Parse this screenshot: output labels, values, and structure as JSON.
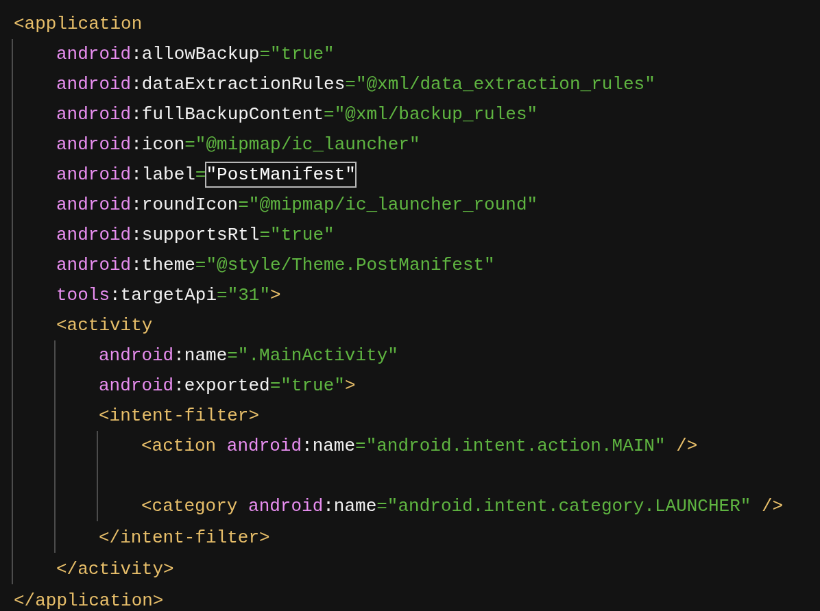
{
  "editor": {
    "lines": [
      {
        "kind": "code",
        "tokens": [
          {
            "kind": "tag",
            "text": "<application"
          }
        ],
        "children": [
          {
            "kind": "code",
            "tokens": [
              {
                "kind": "ns",
                "text": "android"
              },
              {
                "kind": "attr",
                "text": ":allowBackup"
              },
              {
                "kind": "value",
                "text": "=\"true\""
              }
            ]
          },
          {
            "kind": "code",
            "tokens": [
              {
                "kind": "ns",
                "text": "android"
              },
              {
                "kind": "attr",
                "text": ":dataExtractionRules"
              },
              {
                "kind": "value",
                "text": "=\"@xml/data_extraction_rules\""
              }
            ]
          },
          {
            "kind": "code",
            "tokens": [
              {
                "kind": "ns",
                "text": "android"
              },
              {
                "kind": "attr",
                "text": ":fullBackupContent"
              },
              {
                "kind": "value",
                "text": "=\"@xml/backup_rules\""
              }
            ]
          },
          {
            "kind": "code",
            "tokens": [
              {
                "kind": "ns",
                "text": "android"
              },
              {
                "kind": "attr",
                "text": ":icon"
              },
              {
                "kind": "value",
                "text": "=\"@mipmap/ic_launcher\""
              }
            ]
          },
          {
            "kind": "code",
            "tokens": [
              {
                "kind": "ns",
                "text": "android"
              },
              {
                "kind": "attr",
                "text": ":label"
              },
              {
                "kind": "value",
                "text": "="
              },
              {
                "kind": "highlight",
                "text": "\"PostManifest\""
              }
            ]
          },
          {
            "kind": "code",
            "tokens": [
              {
                "kind": "ns",
                "text": "android"
              },
              {
                "kind": "attr",
                "text": ":roundIcon"
              },
              {
                "kind": "value",
                "text": "=\"@mipmap/ic_launcher_round\""
              }
            ]
          },
          {
            "kind": "code",
            "tokens": [
              {
                "kind": "ns",
                "text": "android"
              },
              {
                "kind": "attr",
                "text": ":supportsRtl"
              },
              {
                "kind": "value",
                "text": "=\"true\""
              }
            ]
          },
          {
            "kind": "code",
            "tokens": [
              {
                "kind": "ns",
                "text": "android"
              },
              {
                "kind": "attr",
                "text": ":theme"
              },
              {
                "kind": "value",
                "text": "=\"@style/Theme.PostManifest\""
              }
            ]
          },
          {
            "kind": "code",
            "tokens": [
              {
                "kind": "ns",
                "text": "tools"
              },
              {
                "kind": "attr",
                "text": ":targetApi"
              },
              {
                "kind": "value",
                "text": "=\"31\""
              },
              {
                "kind": "tag",
                "text": ">"
              }
            ]
          },
          {
            "kind": "code",
            "tokens": [
              {
                "kind": "tag",
                "text": "<activity"
              }
            ],
            "children": [
              {
                "kind": "code",
                "tokens": [
                  {
                    "kind": "ns",
                    "text": "android"
                  },
                  {
                    "kind": "attr",
                    "text": ":name"
                  },
                  {
                    "kind": "value",
                    "text": "=\".MainActivity\""
                  }
                ]
              },
              {
                "kind": "code",
                "tokens": [
                  {
                    "kind": "ns",
                    "text": "android"
                  },
                  {
                    "kind": "attr",
                    "text": ":exported"
                  },
                  {
                    "kind": "value",
                    "text": "=\"true\""
                  },
                  {
                    "kind": "tag",
                    "text": ">"
                  }
                ]
              },
              {
                "kind": "code",
                "tokens": [
                  {
                    "kind": "tag",
                    "text": "<intent-filter>"
                  }
                ],
                "children": [
                  {
                    "kind": "code",
                    "tokens": [
                      {
                        "kind": "tag",
                        "text": "<action "
                      },
                      {
                        "kind": "ns",
                        "text": "android"
                      },
                      {
                        "kind": "attr",
                        "text": ":name"
                      },
                      {
                        "kind": "value",
                        "text": "=\"android.intent.action.MAIN\""
                      },
                      {
                        "kind": "tag",
                        "text": " />"
                      }
                    ]
                  },
                  {
                    "kind": "blank"
                  },
                  {
                    "kind": "code",
                    "tokens": [
                      {
                        "kind": "tag",
                        "text": "<category "
                      },
                      {
                        "kind": "ns",
                        "text": "android"
                      },
                      {
                        "kind": "attr",
                        "text": ":name"
                      },
                      {
                        "kind": "value",
                        "text": "=\"android.intent.category.LAUNCHER\""
                      },
                      {
                        "kind": "tag",
                        "text": " />"
                      }
                    ]
                  }
                ]
              },
              {
                "kind": "code",
                "tokens": [
                  {
                    "kind": "tag",
                    "text": "</intent-filter>"
                  }
                ]
              }
            ]
          },
          {
            "kind": "code",
            "tokens": [
              {
                "kind": "tag",
                "text": "</activity>"
              }
            ]
          }
        ]
      },
      {
        "kind": "code",
        "tokens": [
          {
            "kind": "tag",
            "text": "</application>"
          }
        ]
      }
    ]
  }
}
